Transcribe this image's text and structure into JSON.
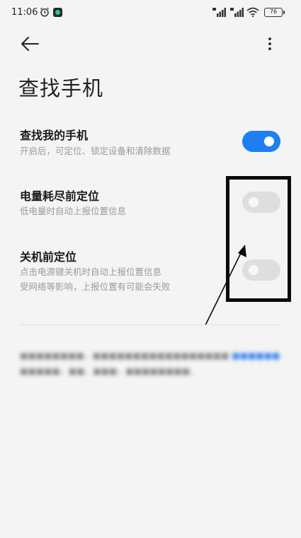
{
  "status_bar": {
    "time": "11:06",
    "battery": "76"
  },
  "header": {
    "title": "查找手机"
  },
  "settings": [
    {
      "title": "查找我的手机",
      "desc_lines": [
        "开启后，可定位、锁定设备和清除数据"
      ],
      "enabled": true
    },
    {
      "title": "电量耗尽前定位",
      "desc_lines": [
        "低电量时自动上报位置信息"
      ],
      "enabled": false
    },
    {
      "title": "关机前定位",
      "desc_lines": [
        "点击电源键关机时自动上报位置信息",
        "受网络等影响，上报位置有可能会失败"
      ],
      "enabled": false
    }
  ],
  "colors": {
    "accent": "#1f7ff2",
    "toggle_off": "#dedede",
    "background": "#f4f4f4",
    "annotation": "#0a0a0a"
  },
  "icons": {
    "back": "arrow-left-icon",
    "more": "more-vertical-icon",
    "alarm": "alarm-clock-icon",
    "signal": "cellular-signal-icon",
    "wifi": "wifi-icon",
    "battery": "battery-icon"
  }
}
